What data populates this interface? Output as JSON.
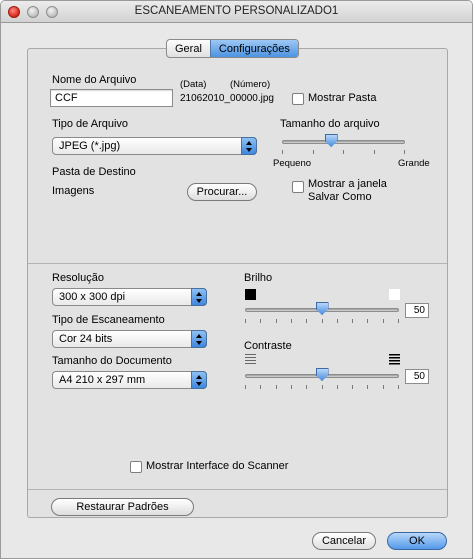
{
  "window": {
    "title": "ESCANEAMENTO PERSONALIZADO1"
  },
  "tabs": [
    {
      "label": "Geral",
      "active": false
    },
    {
      "label": "Configurações",
      "active": true
    }
  ],
  "file_name": {
    "label": "Nome do Arquivo",
    "data_tag": "(Data)",
    "number_tag": "(Número)",
    "value": "CCF",
    "suffix": "21062010_00000.jpg",
    "show_folder_label": "Mostrar Pasta",
    "show_folder_checked": false
  },
  "file_type": {
    "label": "Tipo de Arquivo",
    "selected": "JPEG (*.jpg)"
  },
  "file_size": {
    "label": "Tamanho do arquivo",
    "min_label": "Pequeno",
    "max_label": "Grande",
    "level": 0.4
  },
  "destination": {
    "label": "Pasta de Destino",
    "value": "Imagens",
    "browse_label": "Procurar..."
  },
  "save_as": {
    "label_line1": "Mostrar a janela",
    "label_line2": "Salvar Como",
    "checked": false
  },
  "resolution": {
    "label": "Resolução",
    "selected": "300 x 300 dpi"
  },
  "scan_type": {
    "label": "Tipo de Escaneamento",
    "selected": "Cor 24 bits"
  },
  "document_size": {
    "label": "Tamanho do Documento",
    "selected": "A4 210 x 297 mm"
  },
  "brightness": {
    "label": "Brilho",
    "value": "50",
    "level": 0.5
  },
  "contrast": {
    "label": "Contraste",
    "value": "50",
    "level": 0.5
  },
  "scanner_interface": {
    "label": "Mostrar Interface do Scanner",
    "checked": false
  },
  "buttons": {
    "restore": "Restaurar Padrões",
    "cancel": "Cancelar",
    "ok": "OK"
  },
  "colors": {
    "accent": "#4c93e3",
    "window_bg": "#e8e8e8",
    "panel_bg": "#e2e2e2"
  }
}
